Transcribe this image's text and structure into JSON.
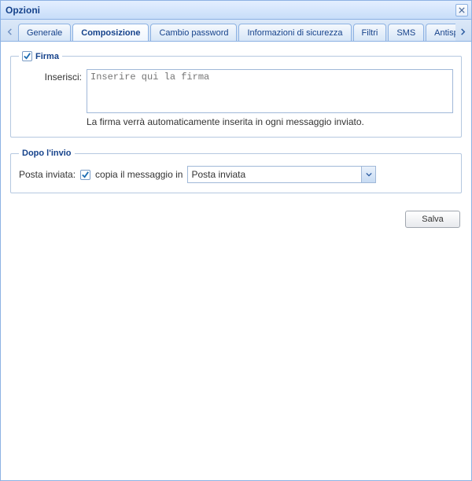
{
  "window": {
    "title": "Opzioni"
  },
  "tabs": {
    "items": [
      {
        "label": "Generale"
      },
      {
        "label": "Composizione"
      },
      {
        "label": "Cambio password"
      },
      {
        "label": "Informazioni di sicurezza"
      },
      {
        "label": "Filtri"
      },
      {
        "label": "SMS"
      },
      {
        "label": "Antispam"
      }
    ],
    "activeIndex": 1
  },
  "firma": {
    "legend": "Firma",
    "checked": true,
    "insert_label": "Inserisci:",
    "placeholder": "Inserire qui la firma",
    "value": "",
    "help": "La firma verrà automaticamente inserita in ogni messaggio inviato."
  },
  "dopo": {
    "legend": "Dopo l'invio",
    "sent_label": "Posta inviata:",
    "copy_checked": true,
    "copy_label": "copia il messaggio in",
    "folder_selected": "Posta inviata"
  },
  "buttons": {
    "save": "Salva"
  }
}
